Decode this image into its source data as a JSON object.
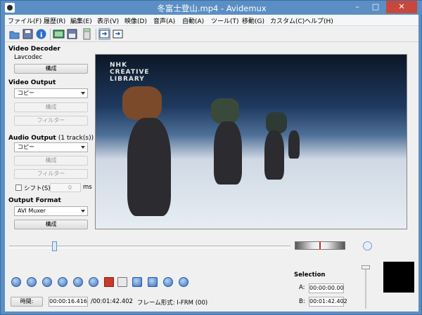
{
  "window": {
    "title": "冬富士登山.mp4 - Avidemux",
    "min": "–",
    "max": "□",
    "close": "✕"
  },
  "menu": [
    "ファイル(F)",
    "履歴(R)",
    "編集(E)",
    "表示(V)",
    "映像(D)",
    "音声(A)",
    "自動(A)",
    "ツール(T)",
    "移動(G)",
    "カスタム(C)",
    "ヘルプ(H)"
  ],
  "toolbar": [
    "open-icon",
    "save-icon",
    "info-icon",
    "open-video-icon",
    "save-video-icon",
    "calc-icon",
    "input-icon",
    "output-icon"
  ],
  "video_decoder": {
    "heading": "Video Decoder",
    "codec": "Lavcodec",
    "config": "構成"
  },
  "video_output": {
    "heading": "Video Output",
    "value": "コピー",
    "config": "構成",
    "filter": "フィルター"
  },
  "audio_output": {
    "heading": "Audio Output",
    "tracks": "(1 track(s))",
    "value": "コピー",
    "config": "構成",
    "filter": "フィルター",
    "shift_label": "シフト(S):",
    "shift_value": "0",
    "unit": "ms"
  },
  "output_format": {
    "heading": "Output Format",
    "value": "AVI Muxer",
    "config": "構成"
  },
  "video": {
    "logo_line1": "NHK",
    "logo_line2": "CREATIVE",
    "logo_line3": "LIBRARY"
  },
  "bottom": {
    "time_btn": "時間:",
    "current": "00:00:16.416",
    "total": "/00:01:42.402",
    "frame_type": "フレーム形式: I-FRM (00)",
    "selection": "Selection",
    "a_label": "A:",
    "a_value": "00:00:00.00",
    "b_label": "B:",
    "b_value": "00:01:42.402"
  },
  "controls": [
    "play-icon",
    "stop-icon",
    "prev-frame-icon",
    "next-frame-icon",
    "prev-keyframe-icon",
    "next-keyframe-icon",
    "set-marker-a-icon",
    "set-marker-b-icon",
    "goto-marker-a-icon",
    "goto-marker-b-icon",
    "goto-start-icon",
    "goto-end-icon"
  ],
  "playback": {
    "position": 0.16
  }
}
